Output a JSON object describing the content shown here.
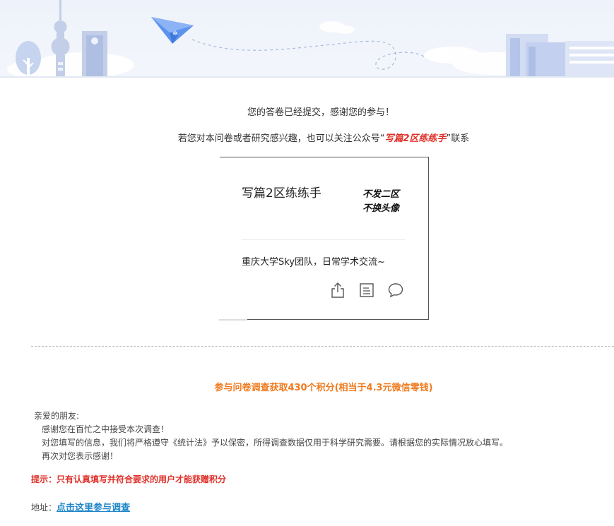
{
  "header": {
    "image_desc": "city-skyline-paper-plane-illustration"
  },
  "message": {
    "submitted": "您的答卷已经提交，感谢您的参与！",
    "follow_prefix": "若您对本问卷或者研究感兴趣，也可以关注公众号“",
    "account_name": "写篇2区练练手",
    "follow_suffix": "”联系"
  },
  "card": {
    "title": "写篇2区练练手",
    "slogan": "不发二区\n不换头像",
    "description": "重庆大学Sky团队，日常学术交流~",
    "icons": [
      "share-icon",
      "document-icon",
      "chat-icon"
    ]
  },
  "reward": {
    "text": "参与问卷调查获取430个积分(相当于4.3元微信零钱)"
  },
  "letter": {
    "greeting": "亲爱的朋友:",
    "line1": "感谢您在百忙之中接受本次调查！",
    "line2": "对您填写的信息，我们将严格遵守《统计法》予以保密，所得调查数据仅用于科学研究需要。请根据您的实际情况放心填写。",
    "line3": "再次对您表示感谢！"
  },
  "tip": {
    "text": "提示：只有认真填写并符合要求的用户才能获赠积分"
  },
  "address": {
    "label": "地址：",
    "link_text": "点击这里参与调查"
  },
  "colors": {
    "accent_red": "#e0312a",
    "reward_orange": "#f07a1e",
    "link_blue": "#1f86c9"
  }
}
